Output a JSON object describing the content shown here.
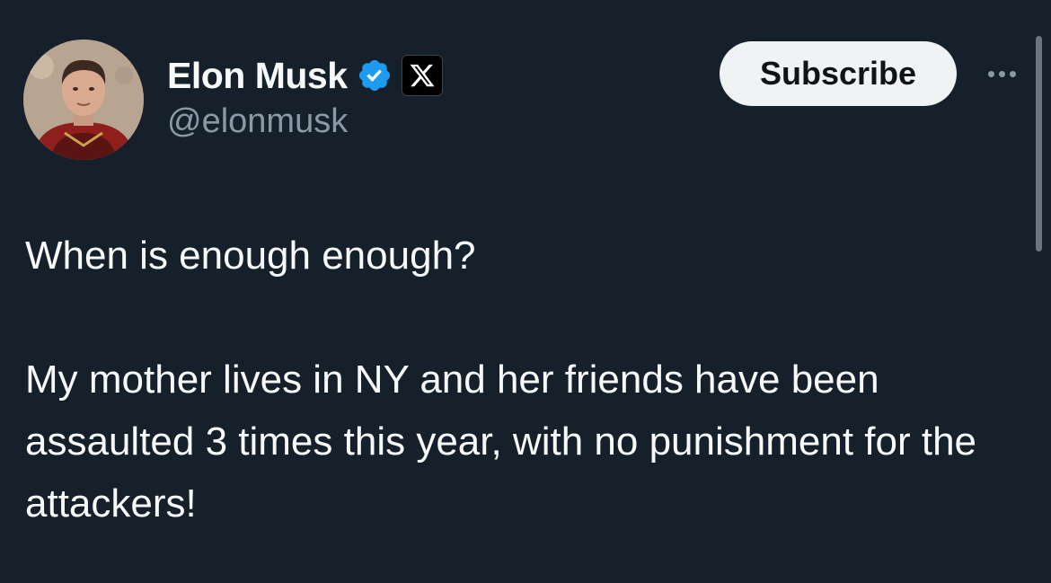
{
  "author": {
    "display_name": "Elon Musk",
    "handle": "@elonmusk",
    "verified_icon": "verified-badge-icon",
    "affiliate_icon": "x-logo-icon"
  },
  "actions": {
    "subscribe_label": "Subscribe",
    "more_icon": "more-horizontal-icon"
  },
  "tweet": {
    "paragraphs": [
      "When is enough enough?",
      "My mother lives in NY and her friends have been assaulted 3 times this year, with no punishment for the attackers!"
    ]
  },
  "colors": {
    "background": "#15202b",
    "text": "#f7f9f9",
    "secondary_text": "#8b98a5",
    "verified_blue": "#1d9bf0",
    "button_bg": "#eff3f4"
  }
}
